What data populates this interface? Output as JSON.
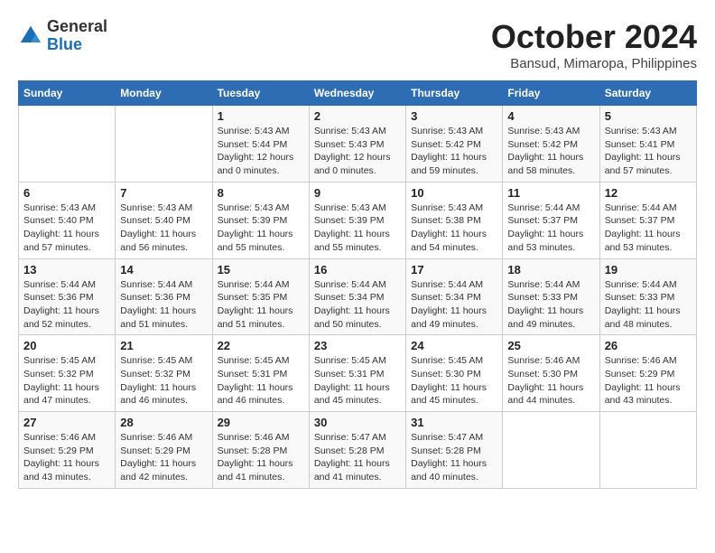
{
  "logo": {
    "general": "General",
    "blue": "Blue"
  },
  "header": {
    "month": "October 2024",
    "location": "Bansud, Mimaropa, Philippines"
  },
  "weekdays": [
    "Sunday",
    "Monday",
    "Tuesday",
    "Wednesday",
    "Thursday",
    "Friday",
    "Saturday"
  ],
  "weeks": [
    [
      {
        "day": "",
        "info": ""
      },
      {
        "day": "",
        "info": ""
      },
      {
        "day": "1",
        "info": "Sunrise: 5:43 AM\nSunset: 5:44 PM\nDaylight: 12 hours\nand 0 minutes."
      },
      {
        "day": "2",
        "info": "Sunrise: 5:43 AM\nSunset: 5:43 PM\nDaylight: 12 hours\nand 0 minutes."
      },
      {
        "day": "3",
        "info": "Sunrise: 5:43 AM\nSunset: 5:42 PM\nDaylight: 11 hours\nand 59 minutes."
      },
      {
        "day": "4",
        "info": "Sunrise: 5:43 AM\nSunset: 5:42 PM\nDaylight: 11 hours\nand 58 minutes."
      },
      {
        "day": "5",
        "info": "Sunrise: 5:43 AM\nSunset: 5:41 PM\nDaylight: 11 hours\nand 57 minutes."
      }
    ],
    [
      {
        "day": "6",
        "info": "Sunrise: 5:43 AM\nSunset: 5:40 PM\nDaylight: 11 hours\nand 57 minutes."
      },
      {
        "day": "7",
        "info": "Sunrise: 5:43 AM\nSunset: 5:40 PM\nDaylight: 11 hours\nand 56 minutes."
      },
      {
        "day": "8",
        "info": "Sunrise: 5:43 AM\nSunset: 5:39 PM\nDaylight: 11 hours\nand 55 minutes."
      },
      {
        "day": "9",
        "info": "Sunrise: 5:43 AM\nSunset: 5:39 PM\nDaylight: 11 hours\nand 55 minutes."
      },
      {
        "day": "10",
        "info": "Sunrise: 5:43 AM\nSunset: 5:38 PM\nDaylight: 11 hours\nand 54 minutes."
      },
      {
        "day": "11",
        "info": "Sunrise: 5:44 AM\nSunset: 5:37 PM\nDaylight: 11 hours\nand 53 minutes."
      },
      {
        "day": "12",
        "info": "Sunrise: 5:44 AM\nSunset: 5:37 PM\nDaylight: 11 hours\nand 53 minutes."
      }
    ],
    [
      {
        "day": "13",
        "info": "Sunrise: 5:44 AM\nSunset: 5:36 PM\nDaylight: 11 hours\nand 52 minutes."
      },
      {
        "day": "14",
        "info": "Sunrise: 5:44 AM\nSunset: 5:36 PM\nDaylight: 11 hours\nand 51 minutes."
      },
      {
        "day": "15",
        "info": "Sunrise: 5:44 AM\nSunset: 5:35 PM\nDaylight: 11 hours\nand 51 minutes."
      },
      {
        "day": "16",
        "info": "Sunrise: 5:44 AM\nSunset: 5:34 PM\nDaylight: 11 hours\nand 50 minutes."
      },
      {
        "day": "17",
        "info": "Sunrise: 5:44 AM\nSunset: 5:34 PM\nDaylight: 11 hours\nand 49 minutes."
      },
      {
        "day": "18",
        "info": "Sunrise: 5:44 AM\nSunset: 5:33 PM\nDaylight: 11 hours\nand 49 minutes."
      },
      {
        "day": "19",
        "info": "Sunrise: 5:44 AM\nSunset: 5:33 PM\nDaylight: 11 hours\nand 48 minutes."
      }
    ],
    [
      {
        "day": "20",
        "info": "Sunrise: 5:45 AM\nSunset: 5:32 PM\nDaylight: 11 hours\nand 47 minutes."
      },
      {
        "day": "21",
        "info": "Sunrise: 5:45 AM\nSunset: 5:32 PM\nDaylight: 11 hours\nand 46 minutes."
      },
      {
        "day": "22",
        "info": "Sunrise: 5:45 AM\nSunset: 5:31 PM\nDaylight: 11 hours\nand 46 minutes."
      },
      {
        "day": "23",
        "info": "Sunrise: 5:45 AM\nSunset: 5:31 PM\nDaylight: 11 hours\nand 45 minutes."
      },
      {
        "day": "24",
        "info": "Sunrise: 5:45 AM\nSunset: 5:30 PM\nDaylight: 11 hours\nand 45 minutes."
      },
      {
        "day": "25",
        "info": "Sunrise: 5:46 AM\nSunset: 5:30 PM\nDaylight: 11 hours\nand 44 minutes."
      },
      {
        "day": "26",
        "info": "Sunrise: 5:46 AM\nSunset: 5:29 PM\nDaylight: 11 hours\nand 43 minutes."
      }
    ],
    [
      {
        "day": "27",
        "info": "Sunrise: 5:46 AM\nSunset: 5:29 PM\nDaylight: 11 hours\nand 43 minutes."
      },
      {
        "day": "28",
        "info": "Sunrise: 5:46 AM\nSunset: 5:29 PM\nDaylight: 11 hours\nand 42 minutes."
      },
      {
        "day": "29",
        "info": "Sunrise: 5:46 AM\nSunset: 5:28 PM\nDaylight: 11 hours\nand 41 minutes."
      },
      {
        "day": "30",
        "info": "Sunrise: 5:47 AM\nSunset: 5:28 PM\nDaylight: 11 hours\nand 41 minutes."
      },
      {
        "day": "31",
        "info": "Sunrise: 5:47 AM\nSunset: 5:28 PM\nDaylight: 11 hours\nand 40 minutes."
      },
      {
        "day": "",
        "info": ""
      },
      {
        "day": "",
        "info": ""
      }
    ]
  ]
}
